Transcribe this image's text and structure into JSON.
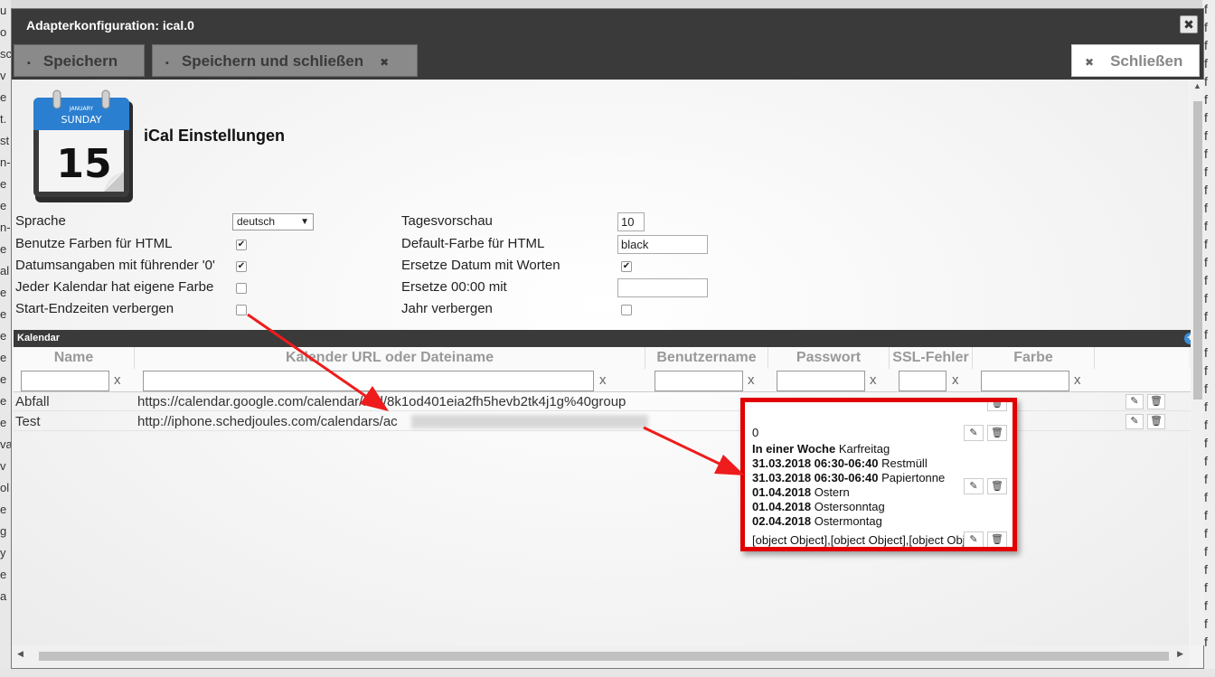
{
  "background": {
    "right_letters": [
      "f",
      "f",
      "f",
      "f",
      "f",
      "f",
      "f",
      "f",
      "f",
      "f",
      "f",
      "f",
      "f",
      "f",
      "f",
      "f",
      "f",
      "f",
      "f",
      "f",
      "f",
      "f",
      "f",
      "f",
      "f",
      "f",
      "f",
      "f",
      "f",
      "f",
      "f",
      "f",
      "f",
      "f",
      "f",
      "f"
    ],
    "left_letters": [
      "u",
      "o",
      "sc",
      "v",
      "e",
      "t.",
      "st",
      "n-",
      "e",
      "e",
      "n-",
      "e",
      "al",
      "e",
      "e",
      "e",
      "e",
      "e",
      "e",
      "e",
      "va",
      "v",
      "ol",
      "e",
      "g",
      "y",
      "e",
      "a"
    ]
  },
  "dialog": {
    "title": "Adapterkonfiguration: ical.0",
    "close_glyph": "✖"
  },
  "toolbar": {
    "save_label": "Speichern",
    "save_close_label": "Speichern und schließen",
    "close_label": "Schließen"
  },
  "header": {
    "title": "iCal Einstellungen",
    "icon_month": "JANUARY",
    "icon_weekday": "SUNDAY",
    "icon_day": "15"
  },
  "settings": {
    "sprache_label": "Sprache",
    "sprache_value": "deutsch",
    "farben_label": "Benutze Farben für HTML",
    "datum_label": "Datumsangaben mit führender '0'",
    "eigene_farbe_label": "Jeder Kalendar hat eigene Farbe",
    "startend_label": "Start-Endzeiten verbergen",
    "tagesvorschau_label": "Tagesvorschau",
    "tagesvorschau_value": "10",
    "default_farbe_label": "Default-Farbe für HTML",
    "default_farbe_value": "black",
    "ersetze_datum_label": "Ersetze Datum mit Worten",
    "ersetze_0000_label": "Ersetze 00:00 mit",
    "ersetze_0000_value": "",
    "jahr_label": "Jahr verbergen",
    "checked": {
      "farben": true,
      "datum": true,
      "eigene_farbe": false,
      "startend": false,
      "ersetze_datum": true,
      "jahr": false
    }
  },
  "kalendar": {
    "title": "Kalendar",
    "columns": [
      "Name",
      "Kalender URL oder Dateiname",
      "Benutzername",
      "Passwort",
      "SSL-Fehler",
      "Farbe"
    ],
    "filter_clear": "x",
    "rows": [
      {
        "name": "Abfall",
        "url": "https://calendar.google.com/calendar/ical/8k1od401eia2fh5hevb2tk4j1g%40group"
      },
      {
        "name": "Test",
        "url": "http://iphone.schedjoules.com/calendars/ac"
      }
    ]
  },
  "popup": {
    "count": "0",
    "week_label": "In einer Woche",
    "week_event": "Karfreitag",
    "events": [
      {
        "date": "31.03.2018 06:30-06:40",
        "name": "Restmüll"
      },
      {
        "date": "31.03.2018 06:30-06:40",
        "name": "Papiertonne"
      },
      {
        "date": "01.04.2018",
        "name": "Ostern"
      },
      {
        "date": "01.04.2018",
        "name": "Ostersonntag"
      },
      {
        "date": "02.04.2018",
        "name": "Ostermontag"
      }
    ],
    "object_text": "[object Object],[object Object],[object Object]"
  },
  "colors": {
    "titlebar": "#3a3a3a",
    "highlight_red": "#e00000",
    "arrow_red": "#ee1c1c",
    "plus_blue": "#3b8ed6"
  },
  "icons": {
    "save": "floppy-icon",
    "close": "close-icon",
    "edit": "pencil-icon",
    "delete": "trash-icon"
  }
}
